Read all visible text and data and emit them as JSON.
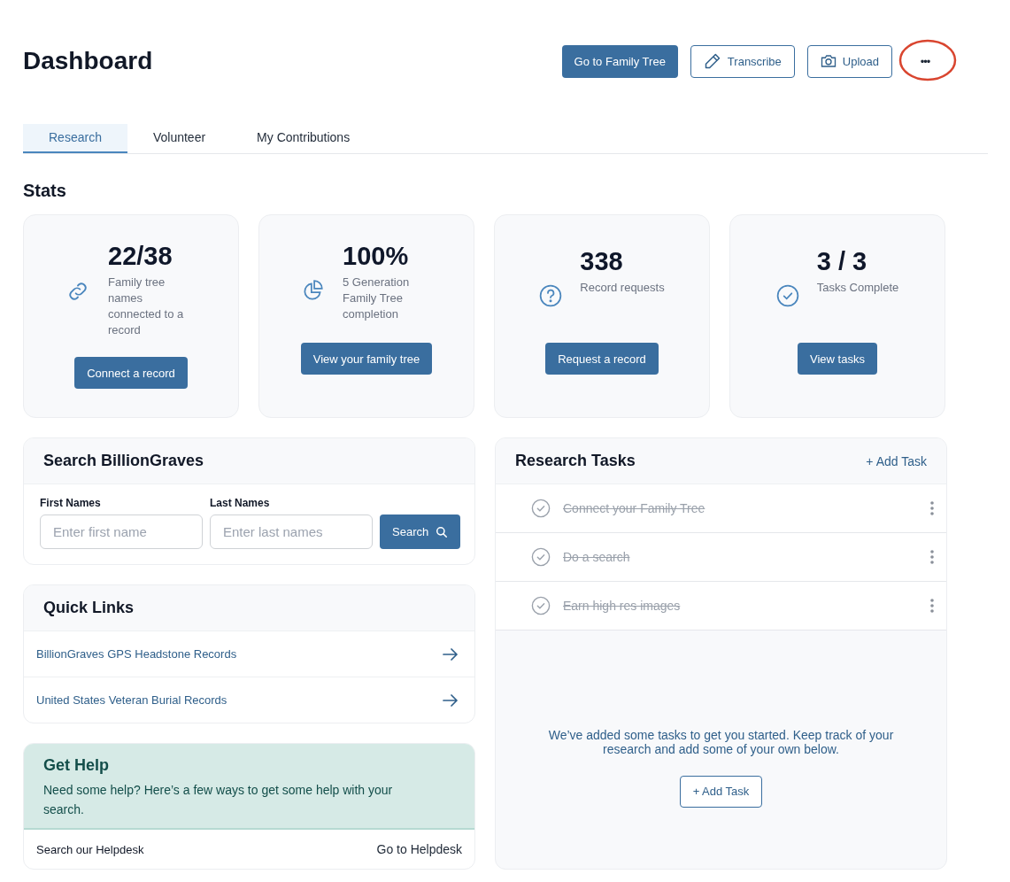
{
  "page": {
    "title": "Dashboard"
  },
  "header_actions": [
    {
      "kind": "primary",
      "label": "Go to Family Tree"
    },
    {
      "kind": "pencil",
      "label": "Transcribe"
    },
    {
      "kind": "camera",
      "label": "Upload"
    },
    {
      "kind": "more",
      "label": "•••",
      "highlighted": true
    }
  ],
  "tabs": [
    {
      "label": "Research",
      "selected": true
    },
    {
      "label": "Volunteer",
      "selected": false
    },
    {
      "label": "My Contributions",
      "selected": false
    }
  ],
  "stats": {
    "title": "Stats",
    "cards": [
      {
        "kind": "link",
        "value": "22/38",
        "label": "Family tree names connected to a record",
        "button": "Connect a record"
      },
      {
        "kind": "pie",
        "value": "100%",
        "label": "5 Generation Family Tree completion",
        "button": "View your family tree"
      },
      {
        "kind": "question",
        "value": "338",
        "label": "Record requests",
        "button": "Request a record"
      },
      {
        "kind": "check",
        "value": "3 / 3",
        "label": "Tasks Complete",
        "button": "View tasks"
      }
    ]
  },
  "search": {
    "title": "Search BillionGraves",
    "fields": [
      {
        "label": "First Names",
        "placeholder": "Enter first name"
      },
      {
        "label": "Last Names",
        "placeholder": "Enter last names"
      }
    ],
    "button": "Search"
  },
  "quick_links": {
    "title": "Quick Links",
    "items": [
      "BillionGraves GPS Headstone Records",
      "United States Veteran Burial Records"
    ]
  },
  "help": {
    "title": "Get Help",
    "text": "Need some help? Here’s a few ways to get some help with your search.",
    "footer_label": "Search our Helpdesk",
    "footer_link": "Go to Helpdesk"
  },
  "research_tasks": {
    "title": "Research Tasks",
    "add_link": "+ Add Task",
    "tasks": [
      {
        "label": "Connect your Family Tree",
        "done": true
      },
      {
        "label": "Do a search",
        "done": true
      },
      {
        "label": "Earn high res images",
        "done": true
      }
    ],
    "empty_message": "We’ve added some tasks to get you started. Keep track of your research and add some of your own below.",
    "add_button": "+ Add Task"
  }
}
